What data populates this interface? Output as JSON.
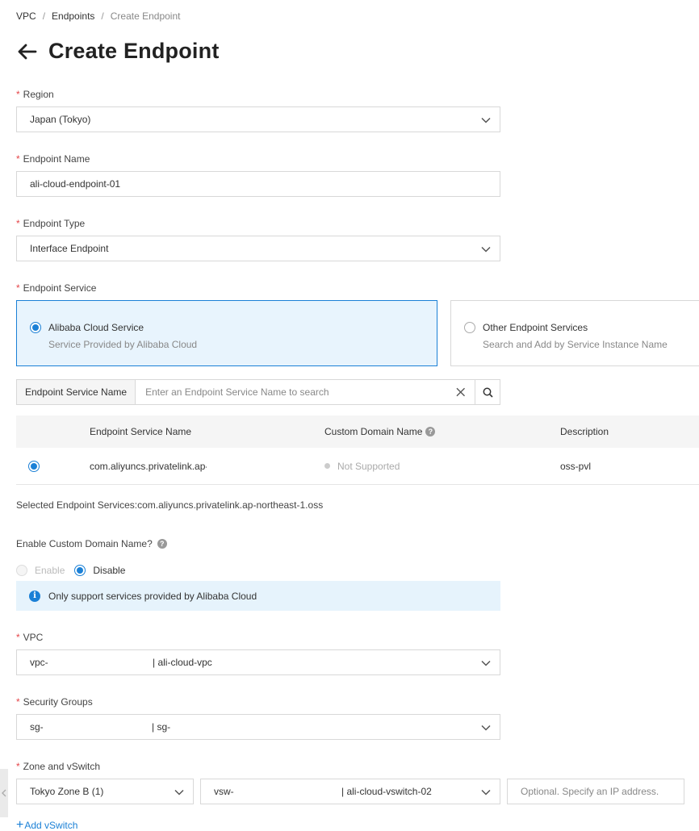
{
  "breadcrumb": {
    "items": [
      "VPC",
      "Endpoints"
    ],
    "current": "Create Endpoint",
    "sep": "/"
  },
  "page": {
    "title": "Create Endpoint"
  },
  "required_mark": "*",
  "region": {
    "label": "Region",
    "value": "Japan (Tokyo)"
  },
  "endpoint_name": {
    "label": "Endpoint Name",
    "value": "ali-cloud-endpoint-01"
  },
  "endpoint_type": {
    "label": "Endpoint Type",
    "value": "Interface Endpoint"
  },
  "endpoint_service": {
    "label": "Endpoint Service",
    "options": [
      {
        "title": "Alibaba Cloud Service",
        "subtitle": "Service Provided by Alibaba Cloud",
        "selected": true
      },
      {
        "title": "Other Endpoint Services",
        "subtitle": "Search and Add by Service Instance Name",
        "selected": false
      }
    ]
  },
  "service_search": {
    "addon": "Endpoint Service Name",
    "placeholder": "Enter an Endpoint Service Name to search"
  },
  "service_table": {
    "columns": [
      "Endpoint Service Name",
      "Custom Domain Name",
      "Description"
    ],
    "rows": [
      {
        "name": "com.aliyuncs.privatelink.ap-",
        "custom_domain": "Not Supported",
        "description": "oss-pvl",
        "selected": true
      }
    ]
  },
  "selected_services": "Selected Endpoint Services:com.aliyuncs.privatelink.ap-northeast-1.oss",
  "custom_domain": {
    "label": "Enable Custom Domain Name?",
    "enable_label": "Enable",
    "disable_label": "Disable",
    "selected": "Disable",
    "info": "Only support services provided by Alibaba Cloud"
  },
  "vpc": {
    "label": "VPC",
    "id_prefix": "vpc-",
    "name": "| ali-cloud-vpc"
  },
  "security_groups": {
    "label": "Security Groups",
    "id_prefix": "sg-",
    "name": "| sg-"
  },
  "zone_vswitch": {
    "label": "Zone and vSwitch",
    "zone": "Tokyo Zone B (1)",
    "vswitch_prefix": "vsw-",
    "vswitch_name": "| ali-cloud-vswitch-02",
    "ip_placeholder": "Optional. Specify an IP address.",
    "add_label": "Add vSwitch"
  },
  "colors": {
    "primary": "#1b80d6",
    "required": "#e5464a",
    "selected_card_bg": "#e8f4fd",
    "info_bg": "#e6f3fc"
  }
}
